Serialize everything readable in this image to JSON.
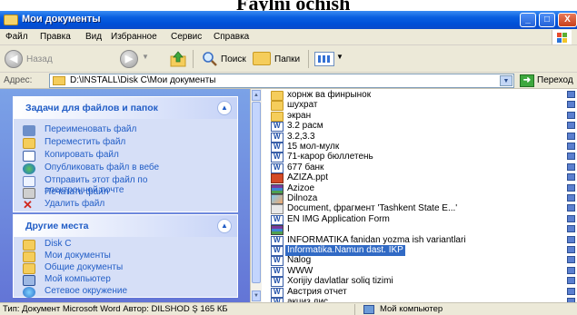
{
  "heading": {
    "text": "Faylni ochish"
  },
  "window": {
    "title": "Мои документы",
    "controls": {
      "minimize": "_",
      "maximize": "□",
      "close": "X"
    }
  },
  "menu": [
    "Файл",
    "Правка",
    "Вид",
    "Избранное",
    "Сервис",
    "Справка"
  ],
  "toolbar": {
    "back_label": "Назад",
    "search_label": "Поиск",
    "folders_label": "Папки"
  },
  "address": {
    "label": "Адрес:",
    "path": "D:\\INSTALL\\Disk C\\Мои документы",
    "go_label": "Переход"
  },
  "tasks_panel": {
    "title": "Задачи для файлов и папок",
    "items": [
      {
        "label": "Переименовать файл",
        "icon": "rename-icon"
      },
      {
        "label": "Переместить файл",
        "icon": "move-icon"
      },
      {
        "label": "Копировать файл",
        "icon": "copy-icon"
      },
      {
        "label": "Опубликовать файл в вебе",
        "icon": "web-publish-icon"
      },
      {
        "label": "Отправить этот файл по",
        "label2": "электронной почте",
        "icon": "email-icon"
      },
      {
        "label": "Печатать файл",
        "icon": "print-icon"
      },
      {
        "label": "Удалить файл",
        "icon": "delete-icon"
      }
    ]
  },
  "places_panel": {
    "title": "Другие места",
    "items": [
      {
        "label": "Disk C",
        "icon": "folder-icon"
      },
      {
        "label": "Мои документы",
        "icon": "folder-icon"
      },
      {
        "label": "Общие документы",
        "icon": "folder-icon"
      },
      {
        "label": "Мой компьютер",
        "icon": "computer-icon"
      },
      {
        "label": "Сетевое окружение",
        "icon": "network-icon"
      }
    ]
  },
  "files": [
    {
      "name": "хорнж ва финрынок",
      "type": "folder"
    },
    {
      "name": "шухрат",
      "type": "folder"
    },
    {
      "name": "экран",
      "type": "folder"
    },
    {
      "name": "3.2 расм",
      "type": "word"
    },
    {
      "name": "3.2,3.3",
      "type": "word"
    },
    {
      "name": "15 мол-мулк",
      "type": "word"
    },
    {
      "name": "71-карор бюллетень",
      "type": "word"
    },
    {
      "name": "677 банк",
      "type": "word"
    },
    {
      "name": "AZIZA.ppt",
      "type": "ppt"
    },
    {
      "name": "Azizoe",
      "type": "rar"
    },
    {
      "name": "Dilnoza",
      "type": "img"
    },
    {
      "name": "Document, фрагмент 'Tashkent State E...'",
      "type": "gen"
    },
    {
      "name": "EN IMG Application Form",
      "type": "word"
    },
    {
      "name": "I",
      "type": "rar"
    },
    {
      "name": "INFORMATIKA fanidan yozma ish variantlari",
      "type": "word"
    },
    {
      "name": "Informatika.Namun dast. IKP",
      "type": "word",
      "selected": true
    },
    {
      "name": "Nalog",
      "type": "word"
    },
    {
      "name": "WWW",
      "type": "word"
    },
    {
      "name": "Xorijiy davlatlar soliq tizimi",
      "type": "word"
    },
    {
      "name": "Австрия отчет",
      "type": "word"
    },
    {
      "name": "акциз дис",
      "type": "word"
    }
  ],
  "status": {
    "left": "Тип: Документ Microsoft Word Автор: DILSHOD Ş 165 КБ",
    "right": "Мой компьютер"
  },
  "colors": {
    "title_blue": "#0051d8",
    "task_pane": "#7ba2e7",
    "link_blue": "#215dc6",
    "selection": "#316ac5"
  }
}
